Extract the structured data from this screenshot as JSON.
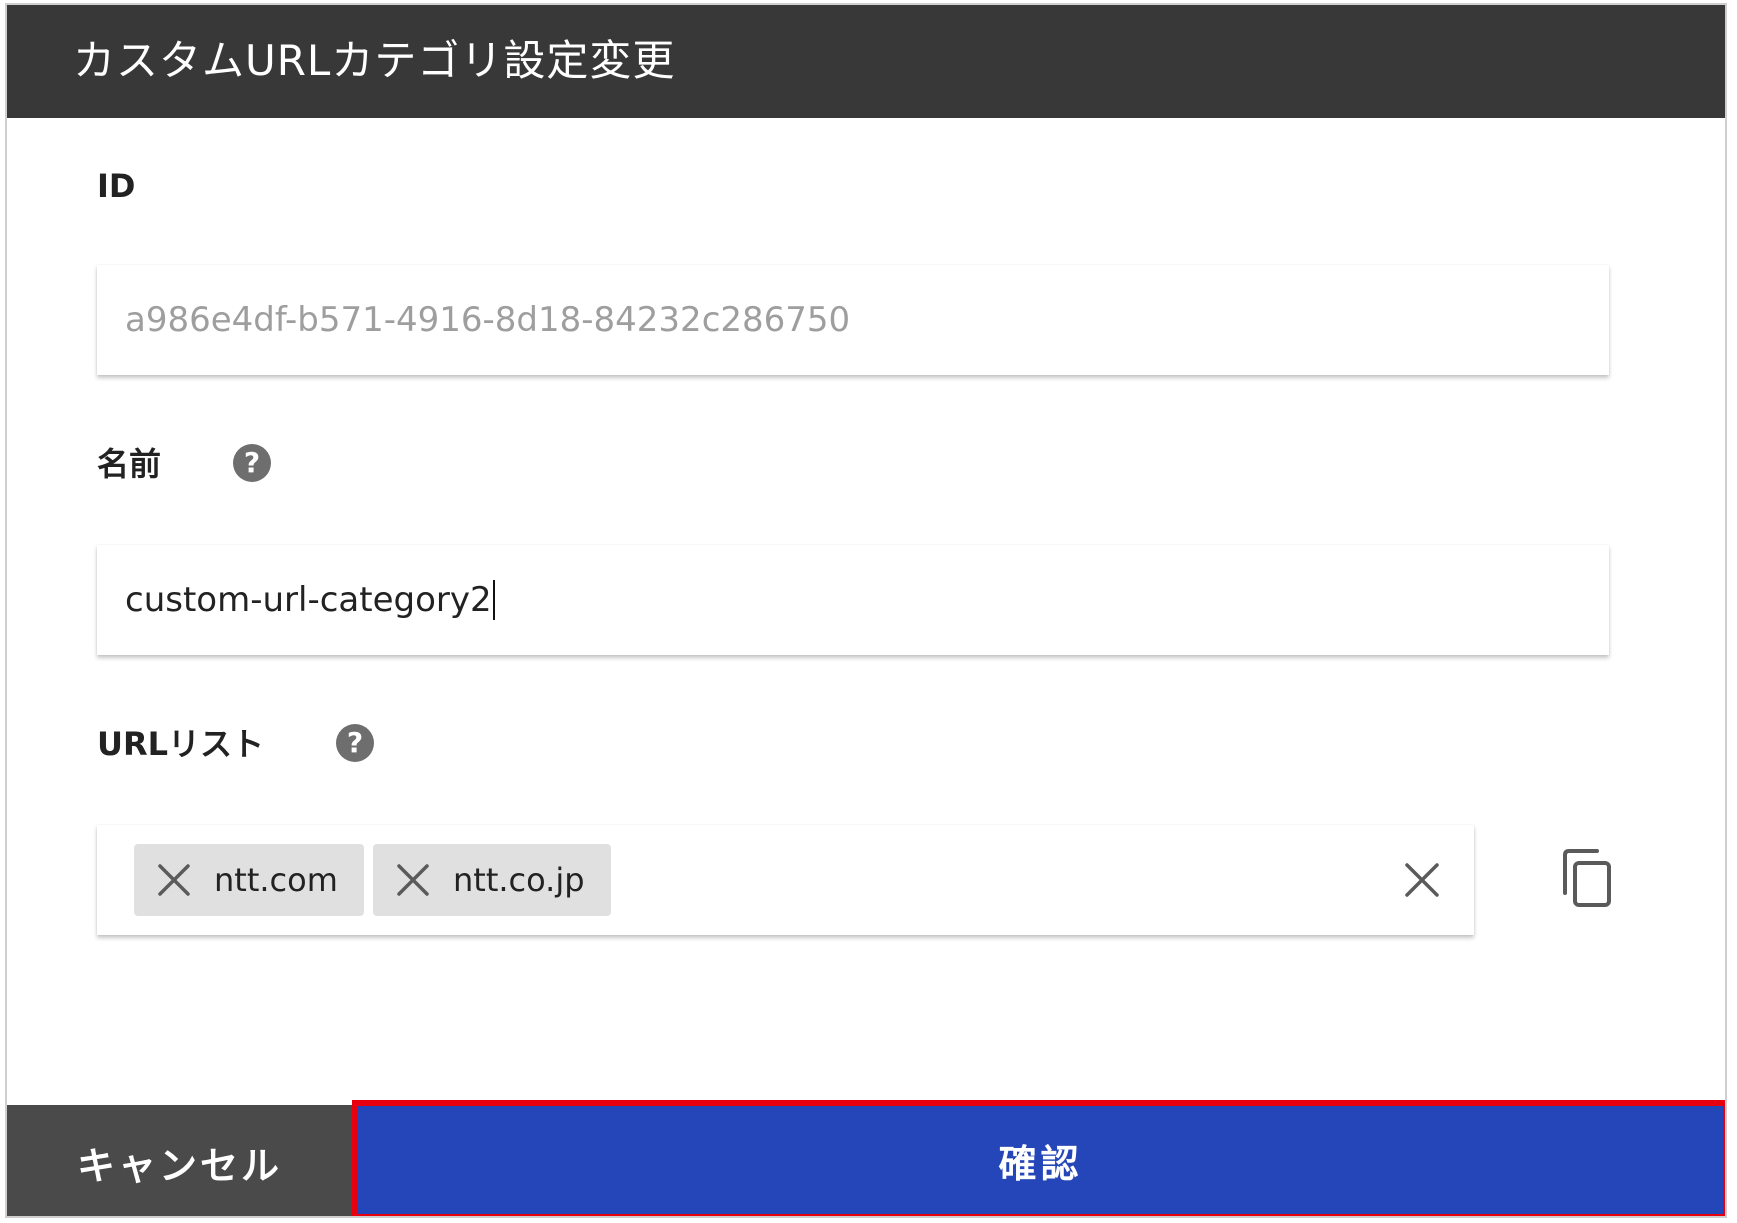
{
  "dialog": {
    "title": "カスタムURLカテゴリ設定変更"
  },
  "fields": {
    "id": {
      "label": "ID",
      "value": "a986e4df-b571-4916-8d18-84232c286750"
    },
    "name": {
      "label": "名前",
      "value": "custom-url-category2",
      "help_icon": "question-circle-icon"
    },
    "url_list": {
      "label": "URLリスト",
      "help_icon": "question-circle-icon",
      "chips": [
        "ntt.com",
        "ntt.co.jp"
      ],
      "chip_remove_icon": "close-icon",
      "clear_icon": "close-icon",
      "copy_icon": "copy-icon"
    }
  },
  "footer": {
    "cancel_label": "キャンセル",
    "confirm_label": "確認"
  },
  "colors": {
    "title_bar": "#383838",
    "cancel_button": "#4a4a4a",
    "confirm_button": "#2446b8",
    "highlight_border": "#e8000f",
    "chip_background": "#e0e0e0"
  }
}
